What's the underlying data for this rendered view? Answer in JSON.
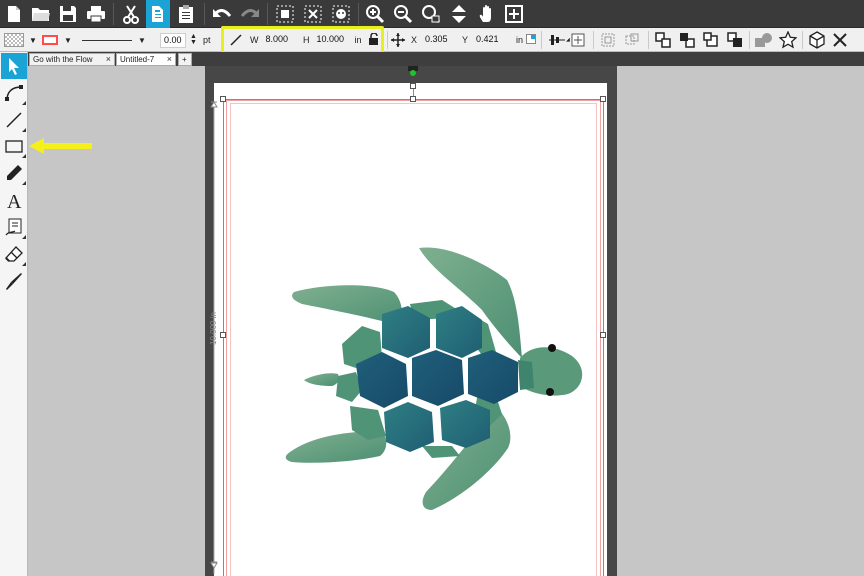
{
  "toolbar": {
    "buttons": [
      {
        "name": "new-document-icon"
      },
      {
        "name": "open-folder-icon"
      },
      {
        "name": "save-icon"
      },
      {
        "name": "print-icon"
      },
      {
        "name": "cut-icon"
      },
      {
        "name": "copy-icon"
      },
      {
        "name": "paste-icon"
      },
      {
        "name": "undo-icon"
      },
      {
        "name": "redo-icon"
      },
      {
        "name": "select-all-icon"
      },
      {
        "name": "deselect-icon"
      },
      {
        "name": "select-by-color-icon"
      },
      {
        "name": "zoom-in-icon"
      },
      {
        "name": "zoom-out-icon"
      },
      {
        "name": "zoom-to-selection-icon"
      },
      {
        "name": "move-down-icon"
      },
      {
        "name": "pan-hand-icon"
      },
      {
        "name": "fit-to-window-icon"
      }
    ],
    "accent_color": "#1aa3d4"
  },
  "properties": {
    "line_width_value": "0.00",
    "line_width_unit": "pt",
    "w_label": "W",
    "w_value": "8.000",
    "h_label": "H",
    "h_value": "10.000",
    "size_unit": "in",
    "x_label": "X",
    "x_value": "0.305",
    "y_label": "Y",
    "y_value": "0.421",
    "position_unit": "in",
    "fill_color": "#ff4b4b",
    "highlight_color": "#e8ef1e"
  },
  "tabs": [
    {
      "label": "Go with the Flow",
      "close": "×"
    },
    {
      "label": "Untitled-7",
      "close": "×"
    },
    {
      "label": "+"
    }
  ],
  "tools": [
    {
      "name": "select-tool-icon",
      "active": true
    },
    {
      "name": "edit-points-tool-icon"
    },
    {
      "name": "line-tool-icon"
    },
    {
      "name": "rectangle-tool-icon"
    },
    {
      "name": "pencil-tool-icon"
    },
    {
      "name": "text-tool-icon"
    },
    {
      "name": "sketch-tool-icon"
    },
    {
      "name": "eraser-tool-icon"
    },
    {
      "name": "knife-tool-icon"
    }
  ],
  "canvas": {
    "height_dimension_label": "10.000 in",
    "artwork": "sea-turtle-image",
    "annotation_arrow_color": "#f5ef1a"
  }
}
